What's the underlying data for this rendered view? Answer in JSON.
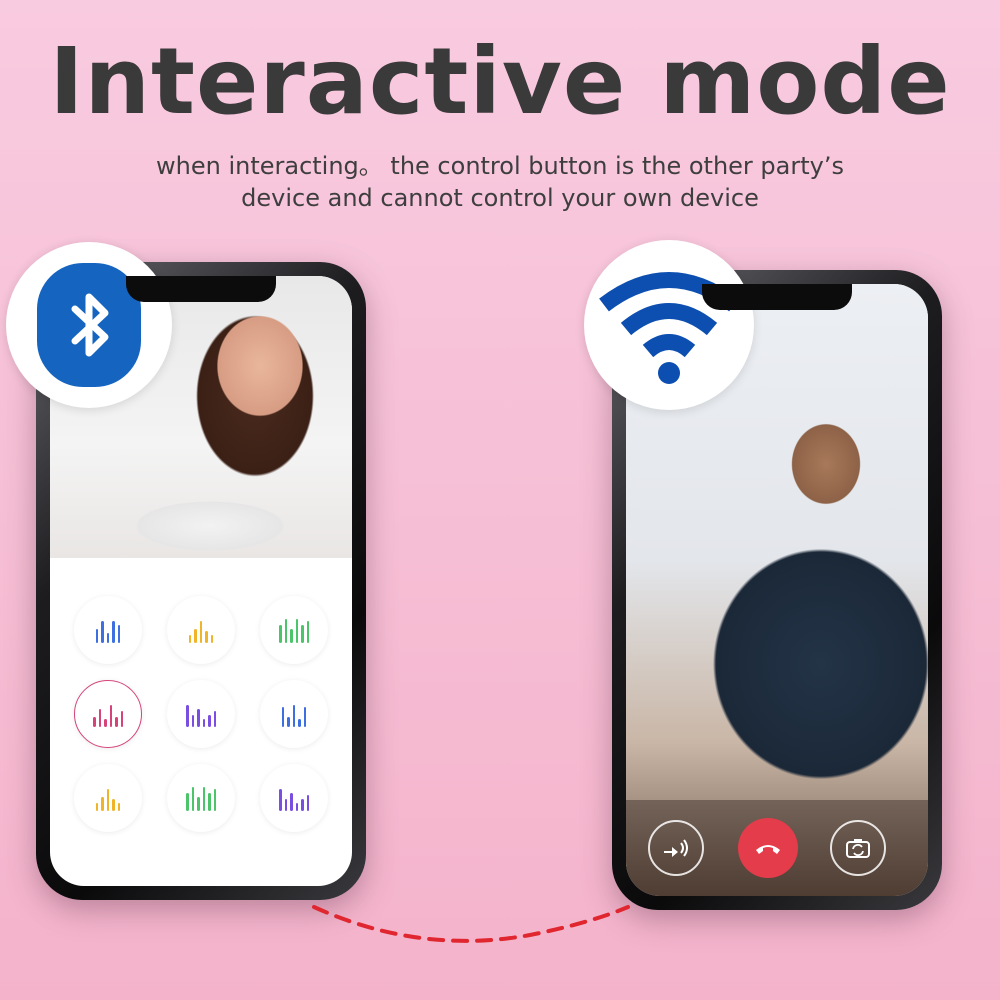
{
  "header": {
    "title": "Interactive mode",
    "subtitle_line1": "when interacting。 the control button is the other party’s",
    "subtitle_line2": "device and cannot control your own device"
  },
  "badges": {
    "bluetooth_icon": "bluetooth-icon",
    "wifi_icon": "wifi-icon",
    "bluetooth_color": "#1565c0",
    "wifi_color": "#0d4fb0"
  },
  "left_phone": {
    "photo": "woman-video-feed",
    "mode_buttons": [
      {
        "name": "mode-1",
        "color": "#3d6fe0",
        "bars": [
          14,
          22,
          10,
          22,
          18
        ]
      },
      {
        "name": "mode-2",
        "color": "#f0b429",
        "bars": [
          8,
          14,
          22,
          12,
          8
        ]
      },
      {
        "name": "mode-3",
        "color": "#4cc46a",
        "bars": [
          18,
          24,
          14,
          24,
          18,
          22
        ]
      },
      {
        "name": "mode-4",
        "color": "#d5437a",
        "bars": [
          10,
          18,
          8,
          22,
          10,
          16
        ],
        "active": true
      },
      {
        "name": "mode-5",
        "color": "#7a4ee0",
        "bars": [
          22,
          12,
          18,
          8,
          12,
          16
        ]
      },
      {
        "name": "mode-6",
        "color": "#3d6fe0",
        "bars": [
          20,
          10,
          22,
          8,
          20
        ]
      },
      {
        "name": "mode-7",
        "color": "#f0b429",
        "bars": [
          8,
          14,
          22,
          12,
          8
        ]
      },
      {
        "name": "mode-8",
        "color": "#4cc46a",
        "bars": [
          18,
          24,
          14,
          24,
          18,
          22
        ]
      },
      {
        "name": "mode-9",
        "color": "#7a4ee0",
        "bars": [
          22,
          12,
          18,
          8,
          12,
          16
        ]
      }
    ]
  },
  "right_phone": {
    "photo": "man-video-feed",
    "controls": {
      "speaker_icon": "speaker-icon",
      "hangup_icon": "hangup-icon",
      "camera_switch_icon": "camera-switch-icon"
    }
  },
  "connection": {
    "line_color": "#e0262f"
  }
}
